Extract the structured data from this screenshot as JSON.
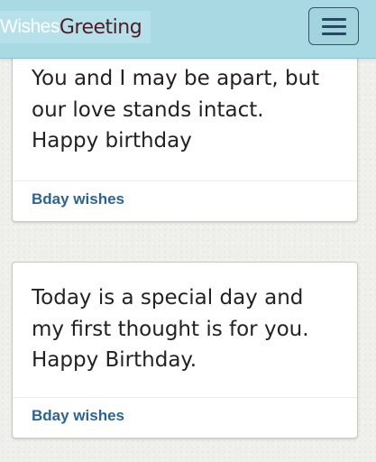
{
  "header": {
    "brand_part1": "Wishes",
    "brand_part2": "Greeting",
    "menu_button_label": "Toggle navigation"
  },
  "cards": [
    {
      "lines": [
        "You and I may be apart, but",
        "our love stands intact.",
        "Happy birthday"
      ],
      "category": "Bday wishes"
    },
    {
      "lines": [
        "Today is a special day and",
        "my first thought is for you.",
        "Happy Birthday."
      ],
      "category": "Bday wishes"
    }
  ],
  "colors": {
    "header_bg": "#a9d9e3",
    "brand_dark": "#4e1e23",
    "link": "#2a6497",
    "page_bg": "#efefec"
  }
}
